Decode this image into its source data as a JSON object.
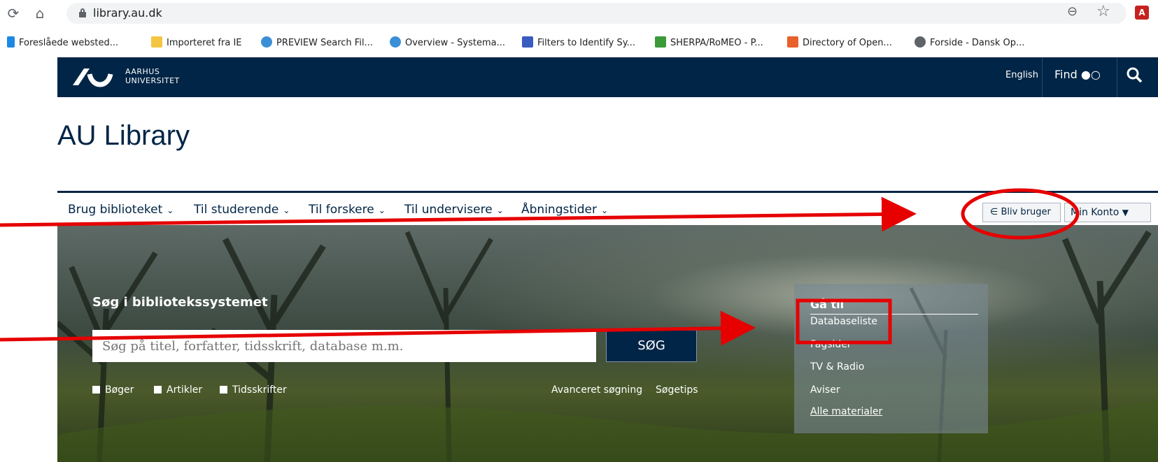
{
  "browser": {
    "url": "library.au.dk",
    "bookmarks": [
      {
        "label": "Foreslåede websted...",
        "icon": "bing-icon",
        "color": "#1e88e5"
      },
      {
        "label": "Importeret fra IE",
        "icon": "folder-icon",
        "color": "#f4c542"
      },
      {
        "label": "PREVIEW Search Fil...",
        "icon": "cloud-icon",
        "color": "#3b8fd6"
      },
      {
        "label": "Overview - Systema...",
        "icon": "cloud-icon",
        "color": "#3b8fd6"
      },
      {
        "label": "Filters to Identify Sy...",
        "icon": "table-icon",
        "color": "#3a5bbf"
      },
      {
        "label": "SHERPA/RoMEO - P...",
        "icon": "mountain-icon",
        "color": "#3a9a3a"
      },
      {
        "label": "Directory of Open...",
        "icon": "books-icon",
        "color": "#e8602c"
      },
      {
        "label": "Forside - Dansk Op...",
        "icon": "globe-icon",
        "color": "#5f6368"
      }
    ]
  },
  "header": {
    "logo_line1": "AARHUS",
    "logo_line2": "UNIVERSITET",
    "english": "English",
    "find": "Find",
    "brand_color": "#002546"
  },
  "page": {
    "title": "AU Library"
  },
  "menu": {
    "items": [
      "Brug biblioteket",
      "Til studerende",
      "Til forskere",
      "Til undervisere",
      "Åbningstider"
    ],
    "bliv_bruger": "Bliv bruger",
    "min_konto": "Min Konto"
  },
  "search": {
    "heading": "Søg i bibliotekssystemet",
    "placeholder": "Søg på titel, forfatter, tidsskrift, database m.m.",
    "button": "SØG",
    "filters": [
      "Bøger",
      "Artikler",
      "Tidsskrifter"
    ],
    "advanced": "Avanceret søgning",
    "tips": "Søgetips"
  },
  "goto": {
    "title": "Gå til",
    "links": [
      "Databaseliste",
      "Fagsider",
      "TV & Radio",
      "Aviser",
      "Alle materialer"
    ]
  },
  "annotations": {
    "color": "#e60000"
  }
}
